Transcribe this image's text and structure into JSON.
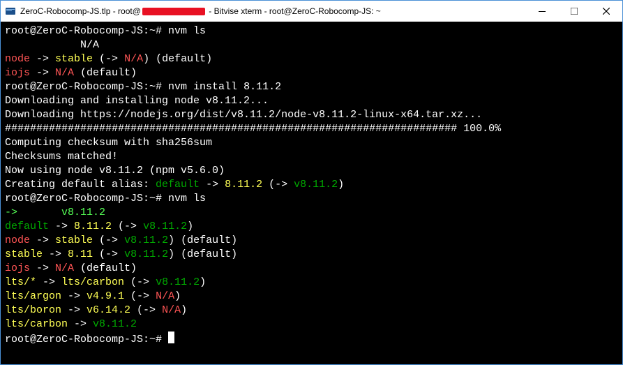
{
  "window": {
    "title_prefix": "ZeroC-Robocomp-JS.tlp - root@",
    "title_suffix": " - Bitvise xterm - root@ZeroC-Robocomp-JS: ~",
    "min_tip": "Minimize",
    "max_tip": "Maximize",
    "close_tip": "Close"
  },
  "term": {
    "prompt1": "root@ZeroC-Robocomp-JS:~# ",
    "cmd_nvm_ls": "nvm ls",
    "na_indent": "            N/A",
    "node_lbl": "node",
    "arrow": " -> ",
    "stable_lbl": "stable",
    "open_arrow": " (-> ",
    "na_red": "N/A",
    "close_paren": ")",
    "default_suffix": " (default)",
    "iojs_lbl": "iojs",
    "cmd_install": "nvm install 8.11.2",
    "dl_line1": "Downloading and installing node v8.11.2...",
    "dl_line2": "Downloading https://nodejs.org/dist/v8.11.2/node-v8.11.2-linux-x64.tar.xz...",
    "hashbar": "######################################################################## 100.0%",
    "checksum_line": "Computing checksum with sha256sum",
    "checksums_matched": "Checksums matched!",
    "now_using": "Now using node v8.11.2 (npm v5.6.0)",
    "creating_prefix": "Creating default alias: ",
    "default_green": "default",
    "v8112_yellow": "8.11.2",
    "v8112_green": "v8.11.2",
    "arrow_green": "->",
    "current_ver_indent": "       ",
    "default_lbl": "default",
    "stable_ver": "8.11",
    "lts_star": "lts/*",
    "lts_carbon_lbl": "lts/carbon",
    "lts_argon": "lts/argon",
    "v491": "v4.9.1",
    "lts_boron": "lts/boron",
    "v6142": "v6.14.2",
    "lts_carbon2": "lts/carbon"
  }
}
